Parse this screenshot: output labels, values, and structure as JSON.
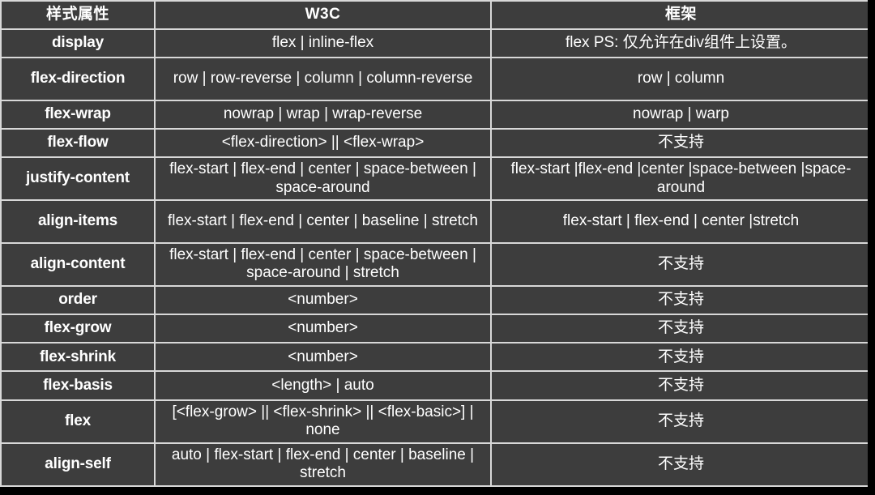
{
  "table": {
    "columns": [
      {
        "key": "property",
        "label": "样式属性"
      },
      {
        "key": "w3c",
        "label": "W3C"
      },
      {
        "key": "framework",
        "label": "框架"
      }
    ],
    "rows": [
      {
        "property": "display",
        "w3c": "flex | inline-flex",
        "framework": "flex  PS: 仅允许在div组件上设置。",
        "tall": false
      },
      {
        "property": "flex-direction",
        "w3c": "row | row-reverse | column | column-reverse",
        "framework": "row | column",
        "tall": true
      },
      {
        "property": "flex-wrap",
        "w3c": "nowrap | wrap | wrap-reverse",
        "framework": "nowrap | warp",
        "tall": false
      },
      {
        "property": "flex-flow",
        "w3c": "<flex-direction> || <flex-wrap>",
        "framework": "不支持",
        "tall": false
      },
      {
        "property": "justify-content",
        "w3c": "flex-start | flex-end | center | space-between | space-around",
        "framework": "flex-start |flex-end |center |space-between |space-around",
        "tall": true
      },
      {
        "property": "align-items",
        "w3c": "flex-start | flex-end | center | baseline | stretch",
        "framework": "flex-start | flex-end | center |stretch",
        "tall": true
      },
      {
        "property": "align-content",
        "w3c": "flex-start | flex-end | center | space-between | space-around | stretch",
        "framework": "不支持",
        "tall": true
      },
      {
        "property": "order",
        "w3c": "<number>",
        "framework": "不支持",
        "tall": false
      },
      {
        "property": "flex-grow",
        "w3c": "<number>",
        "framework": "不支持",
        "tall": false
      },
      {
        "property": "flex-shrink",
        "w3c": "<number>",
        "framework": "不支持",
        "tall": false
      },
      {
        "property": "flex-basis",
        "w3c": "<length> | auto",
        "framework": "不支持",
        "tall": false
      },
      {
        "property": "flex",
        "w3c": "[<flex-grow> || <flex-shrink> || <flex-basic>] | none",
        "framework": "不支持",
        "tall": true
      },
      {
        "property": "align-self",
        "w3c": "auto | flex-start | flex-end | center | baseline | stretch",
        "framework": "不支持",
        "tall": true
      }
    ]
  },
  "colors": {
    "background": "#3d3d3d",
    "border": "#d8d8d8",
    "text": "#ffffff",
    "page": "#000000"
  }
}
